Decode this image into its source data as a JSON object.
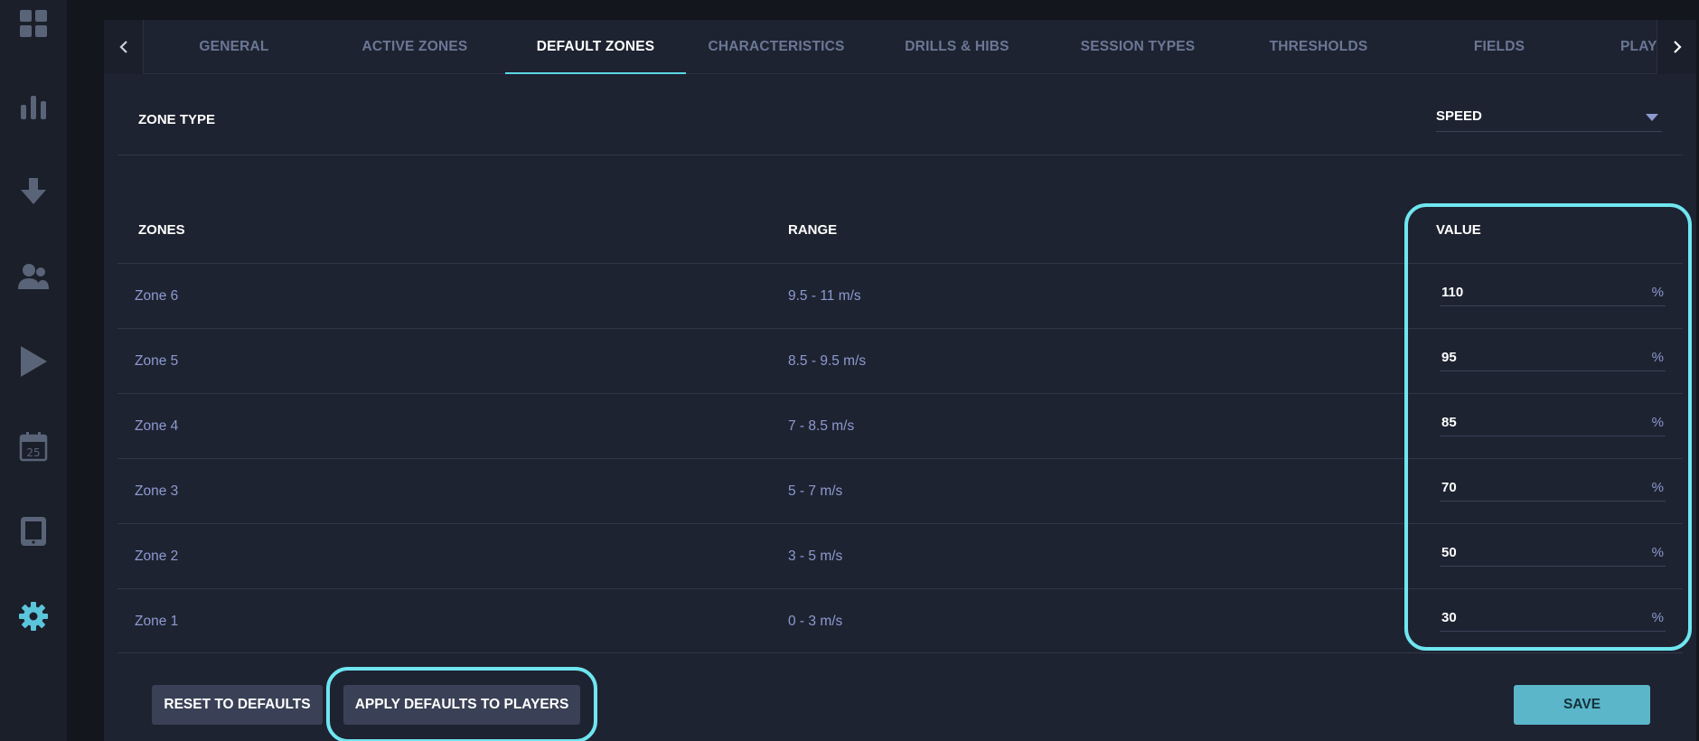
{
  "sidebar": {
    "items": [
      {
        "icon": "grid-icon"
      },
      {
        "icon": "bar-chart-icon"
      },
      {
        "icon": "download-icon"
      },
      {
        "icon": "users-icon"
      },
      {
        "icon": "play-icon"
      },
      {
        "icon": "calendar-icon",
        "day": "25"
      },
      {
        "icon": "tablet-icon"
      },
      {
        "icon": "gear-icon",
        "active": true
      }
    ]
  },
  "tabs": [
    {
      "label": "GENERAL"
    },
    {
      "label": "ACTIVE ZONES"
    },
    {
      "label": "DEFAULT ZONES",
      "active": true
    },
    {
      "label": "CHARACTERISTICS"
    },
    {
      "label": "DRILLS & HIBS"
    },
    {
      "label": "SESSION TYPES"
    },
    {
      "label": "THRESHOLDS"
    },
    {
      "label": "FIELDS"
    },
    {
      "label": "PLAYE"
    }
  ],
  "zone_type": {
    "label": "ZONE TYPE",
    "selected": "SPEED"
  },
  "table": {
    "headers": {
      "zones": "ZONES",
      "range": "RANGE",
      "value": "VALUE"
    },
    "rows": [
      {
        "zone": "Zone 6",
        "range": "9.5 - 11 m/s",
        "value": "110",
        "unit": "%"
      },
      {
        "zone": "Zone 5",
        "range": "8.5 - 9.5 m/s",
        "value": "95",
        "unit": "%"
      },
      {
        "zone": "Zone 4",
        "range": "7 - 8.5 m/s",
        "value": "85",
        "unit": "%"
      },
      {
        "zone": "Zone 3",
        "range": "5 - 7 m/s",
        "value": "70",
        "unit": "%"
      },
      {
        "zone": "Zone 2",
        "range": "3 - 5 m/s",
        "value": "50",
        "unit": "%"
      },
      {
        "zone": "Zone 1",
        "range": "0 - 3 m/s",
        "value": "30",
        "unit": "%"
      }
    ]
  },
  "buttons": {
    "reset": "RESET TO DEFAULTS",
    "apply": "APPLY DEFAULTS TO PLAYERS",
    "save": "SAVE"
  },
  "colors": {
    "accent": "#5bd8e6",
    "highlight": "#6fe6f0",
    "save_bg": "#5ab6c8",
    "muted_text": "#8d9ad0"
  }
}
